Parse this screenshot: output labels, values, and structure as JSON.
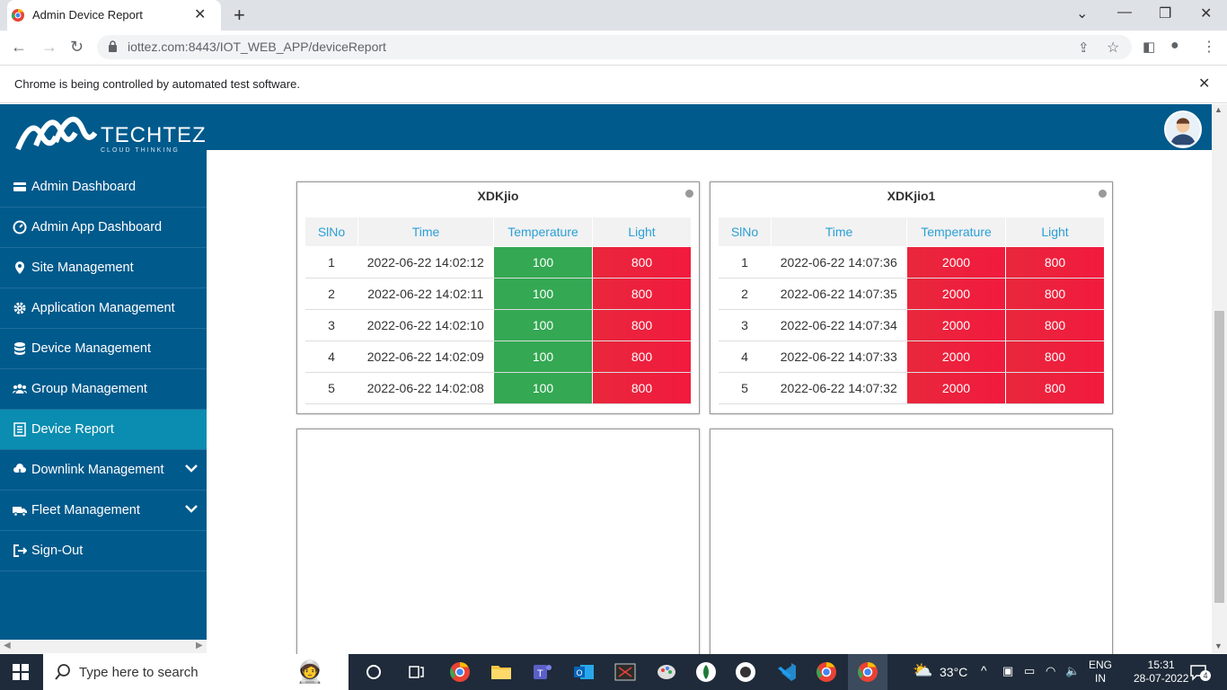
{
  "browser": {
    "tab_title": "Admin Device Report",
    "url": "iottez.com:8443/IOT_WEB_APP/deviceReport",
    "infobar_text": "Chrome is being controlled by automated test software."
  },
  "app": {
    "logo_text": "TECHTEZ",
    "logo_subtext": "CLOUD THINKING"
  },
  "sidebar": {
    "items": [
      {
        "label": "Admin Dashboard",
        "icon": "card-icon"
      },
      {
        "label": "Admin App Dashboard",
        "icon": "dashboard-gauge-icon"
      },
      {
        "label": "Site Management",
        "icon": "map-pin-icon"
      },
      {
        "label": "Application Management",
        "icon": "gear-icon"
      },
      {
        "label": "Device Management",
        "icon": "database-icon"
      },
      {
        "label": "Group Management",
        "icon": "users-icon"
      },
      {
        "label": "Device Report",
        "icon": "list-icon",
        "active": true
      },
      {
        "label": "Downlink Management",
        "icon": "cloud-download-icon",
        "expandable": true
      },
      {
        "label": "Fleet Management",
        "icon": "truck-icon",
        "expandable": true
      },
      {
        "label": "Sign-Out",
        "icon": "sign-out-icon"
      }
    ]
  },
  "reports": [
    {
      "device": "XDKjio",
      "headers": [
        "SlNo",
        "Time",
        "Temperature",
        "Light"
      ],
      "rows": [
        {
          "slno": "1",
          "time": "2022-06-22 14:02:12",
          "temperature": "100",
          "light": "800",
          "temp_status": "green",
          "light_status": "red"
        },
        {
          "slno": "2",
          "time": "2022-06-22 14:02:11",
          "temperature": "100",
          "light": "800",
          "temp_status": "green",
          "light_status": "red"
        },
        {
          "slno": "3",
          "time": "2022-06-22 14:02:10",
          "temperature": "100",
          "light": "800",
          "temp_status": "green",
          "light_status": "red"
        },
        {
          "slno": "4",
          "time": "2022-06-22 14:02:09",
          "temperature": "100",
          "light": "800",
          "temp_status": "green",
          "light_status": "red"
        },
        {
          "slno": "5",
          "time": "2022-06-22 14:02:08",
          "temperature": "100",
          "light": "800",
          "temp_status": "green",
          "light_status": "red"
        }
      ]
    },
    {
      "device": "XDKjio1",
      "headers": [
        "SlNo",
        "Time",
        "Temperature",
        "Light"
      ],
      "rows": [
        {
          "slno": "1",
          "time": "2022-06-22 14:07:36",
          "temperature": "2000",
          "light": "800",
          "temp_status": "red",
          "light_status": "red"
        },
        {
          "slno": "2",
          "time": "2022-06-22 14:07:35",
          "temperature": "2000",
          "light": "800",
          "temp_status": "red",
          "light_status": "red"
        },
        {
          "slno": "3",
          "time": "2022-06-22 14:07:34",
          "temperature": "2000",
          "light": "800",
          "temp_status": "red",
          "light_status": "red"
        },
        {
          "slno": "4",
          "time": "2022-06-22 14:07:33",
          "temperature": "2000",
          "light": "800",
          "temp_status": "red",
          "light_status": "red"
        },
        {
          "slno": "5",
          "time": "2022-06-22 14:07:32",
          "temperature": "2000",
          "light": "800",
          "temp_status": "red",
          "light_status": "red"
        }
      ]
    }
  ],
  "taskbar": {
    "search_placeholder": "Type here to search",
    "weather": "33°C",
    "lang_top": "ENG",
    "lang_bottom": "IN",
    "time": "15:31",
    "date": "28-07-2022",
    "notifications": "4"
  },
  "colors": {
    "brand": "#005a8c",
    "active_nav": "#0a8db0",
    "ok": "#34a853",
    "alert": "#e8273c"
  }
}
